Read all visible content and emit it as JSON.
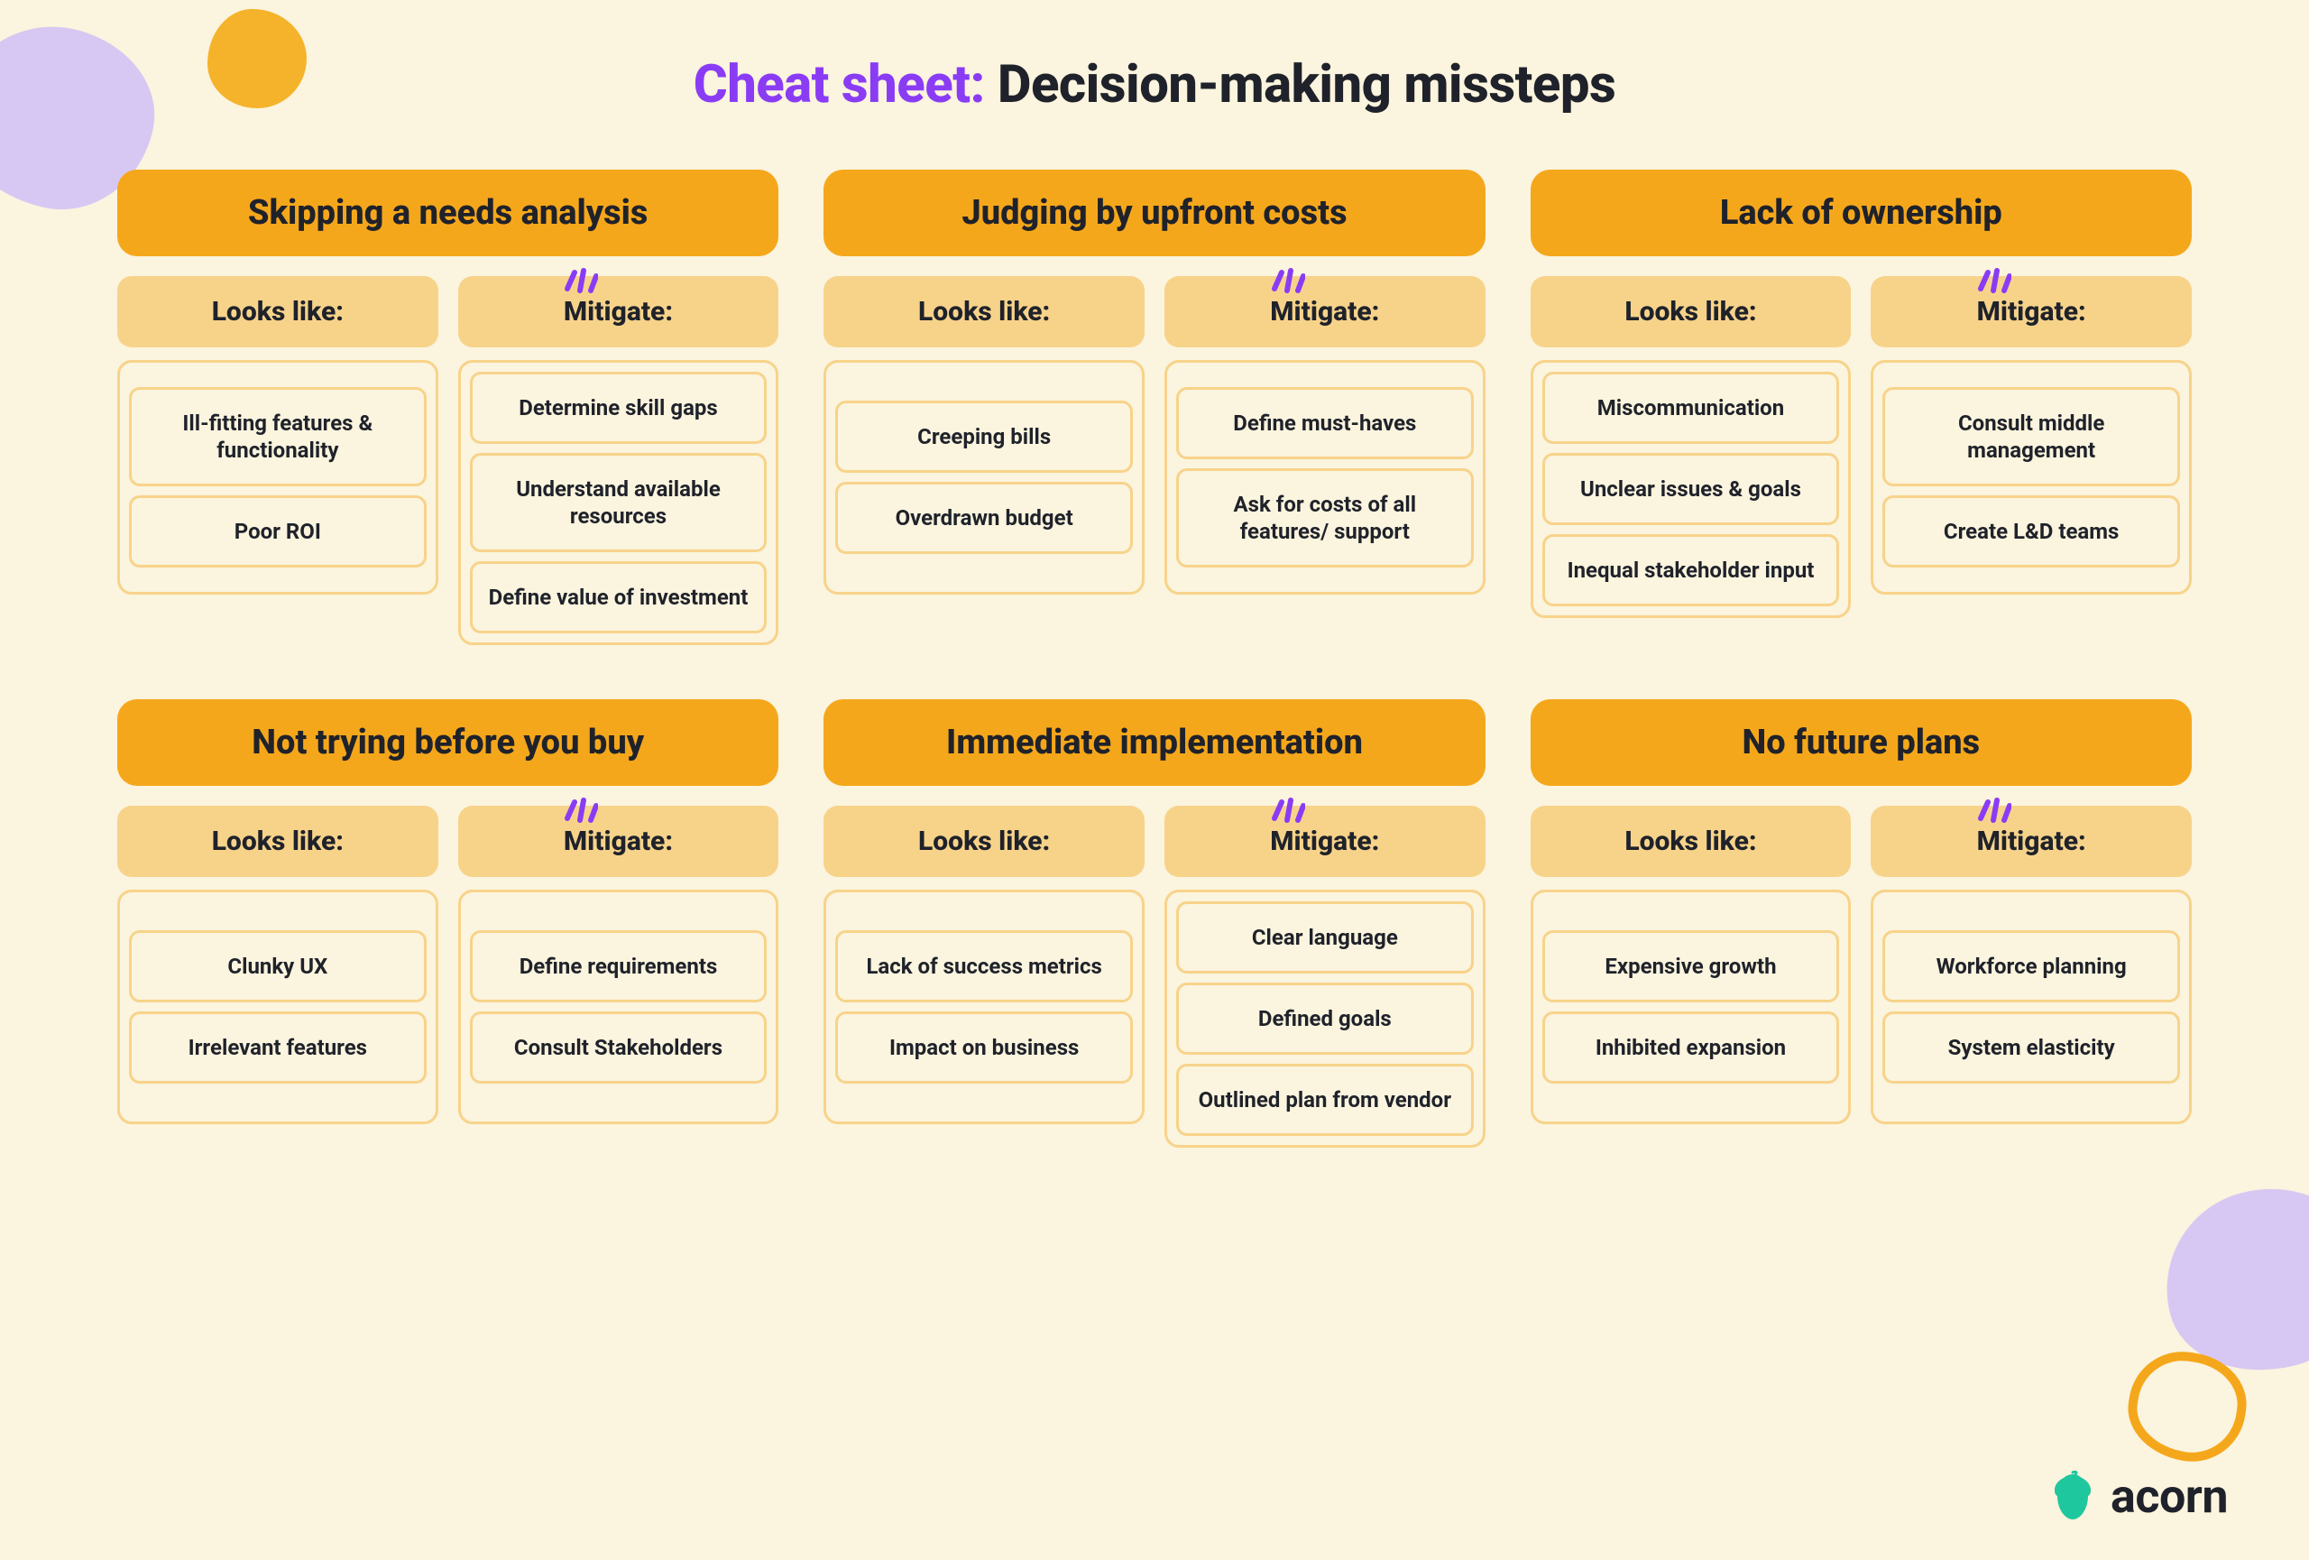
{
  "title_prefix": "Cheat sheet:",
  "title_main": "Decision-making missteps",
  "labels": {
    "looks_like": "Looks like:",
    "mitigate": "Mitigate:"
  },
  "cards": [
    {
      "title": "Skipping a needs analysis",
      "looks_like": [
        "Ill-fitting features & functionality",
        "Poor ROI"
      ],
      "mitigate": [
        "Determine skill gaps",
        "Understand available resources",
        "Define value of investment"
      ]
    },
    {
      "title": "Judging by upfront costs",
      "looks_like": [
        "Creeping bills",
        "Overdrawn budget"
      ],
      "mitigate": [
        "Define must-haves",
        "Ask for costs of all features/ support"
      ]
    },
    {
      "title": "Lack of ownership",
      "looks_like": [
        "Miscommunication",
        "Unclear issues & goals",
        "Inequal stakeholder input"
      ],
      "mitigate": [
        "Consult middle management",
        "Create L&D teams"
      ]
    },
    {
      "title": "Not trying before you buy",
      "looks_like": [
        "Clunky UX",
        "Irrelevant features"
      ],
      "mitigate": [
        "Define requirements",
        "Consult Stakeholders"
      ]
    },
    {
      "title": "Immediate implementation",
      "looks_like": [
        "Lack of success metrics",
        "Impact on business"
      ],
      "mitigate": [
        "Clear language",
        "Defined goals",
        "Outlined plan from vendor"
      ]
    },
    {
      "title": "No future plans",
      "looks_like": [
        "Expensive growth",
        "Inhibited expansion"
      ],
      "mitigate": [
        "Workforce planning",
        "System elasticity"
      ]
    }
  ],
  "brand": "acorn",
  "colors": {
    "bg": "#fbf4de",
    "header": "#f5a71b",
    "sub": "#f7d38a",
    "accent_purple": "#8a3cf5",
    "text": "#1f222a",
    "blob_purple": "#d7c8f3",
    "brand_green": "#1fc79e"
  }
}
